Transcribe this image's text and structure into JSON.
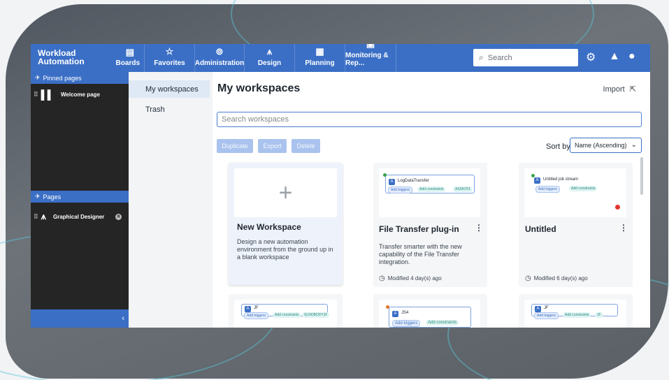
{
  "topbar": {
    "brand_line1": "Workload",
    "brand_line2": "Automation",
    "nav": [
      {
        "label": "Boards",
        "icon": "boards-icon"
      },
      {
        "label": "Favorites",
        "icon": "star-icon"
      },
      {
        "label": "Administration",
        "icon": "admin-icon"
      },
      {
        "label": "Design",
        "icon": "compass-icon"
      },
      {
        "label": "Planning",
        "icon": "calendar-icon"
      },
      {
        "label": "Monitoring & Rep...",
        "icon": "monitor-icon"
      }
    ],
    "search_placeholder": "Search",
    "accent": "#3b6fc6"
  },
  "sidebar": {
    "pinned_header": "Pinned pages",
    "pinned_items": [
      {
        "label": "Welcome page"
      }
    ],
    "pages_header": "Pages",
    "pages_items": [
      {
        "label": "Graphical Designer"
      }
    ]
  },
  "subnav": {
    "items": [
      {
        "label": "My workspaces",
        "active": true
      },
      {
        "label": "Trash",
        "active": false
      }
    ]
  },
  "main": {
    "title": "My workspaces",
    "import_label": "Import",
    "search_placeholder": "Search workspaces",
    "actions": [
      "Duplicate",
      "Export",
      "Delete"
    ],
    "sort_label": "Sort by",
    "sort_value": "Name (Ascending)",
    "cards": [
      {
        "title": "New Workspace",
        "description": "Design a new automation environment from the ground up in a blank workspace"
      },
      {
        "title": "File Transfer plug-in",
        "description": "Transfer smarter with the new capability of the File Transfer integration.",
        "modified": "Modified 4 day(s) ago",
        "thumb_node": "LogDataTransfer",
        "thumb_chips": [
          "Add triggers",
          "Add constraints",
          "ASSN701"
        ]
      },
      {
        "title": "Untitled",
        "modified": "Modified 6 day(s) ago",
        "thumb_node": "Untitled job stream",
        "thumb_chips": [
          "Add triggers",
          "Add constraints"
        ]
      }
    ],
    "row2": [
      {
        "thumb_node": "JF",
        "thumb_chips": [
          "Add triggers",
          "Add constraints",
          "SLNOBODYJF"
        ]
      },
      {
        "thumb_node": "JS4",
        "thumb_chips": [
          "Add triggers",
          "Add constraints"
        ]
      },
      {
        "thumb_node": "JF",
        "thumb_chips": [
          "Add triggers",
          "Add constraints",
          "JF"
        ]
      }
    ]
  }
}
